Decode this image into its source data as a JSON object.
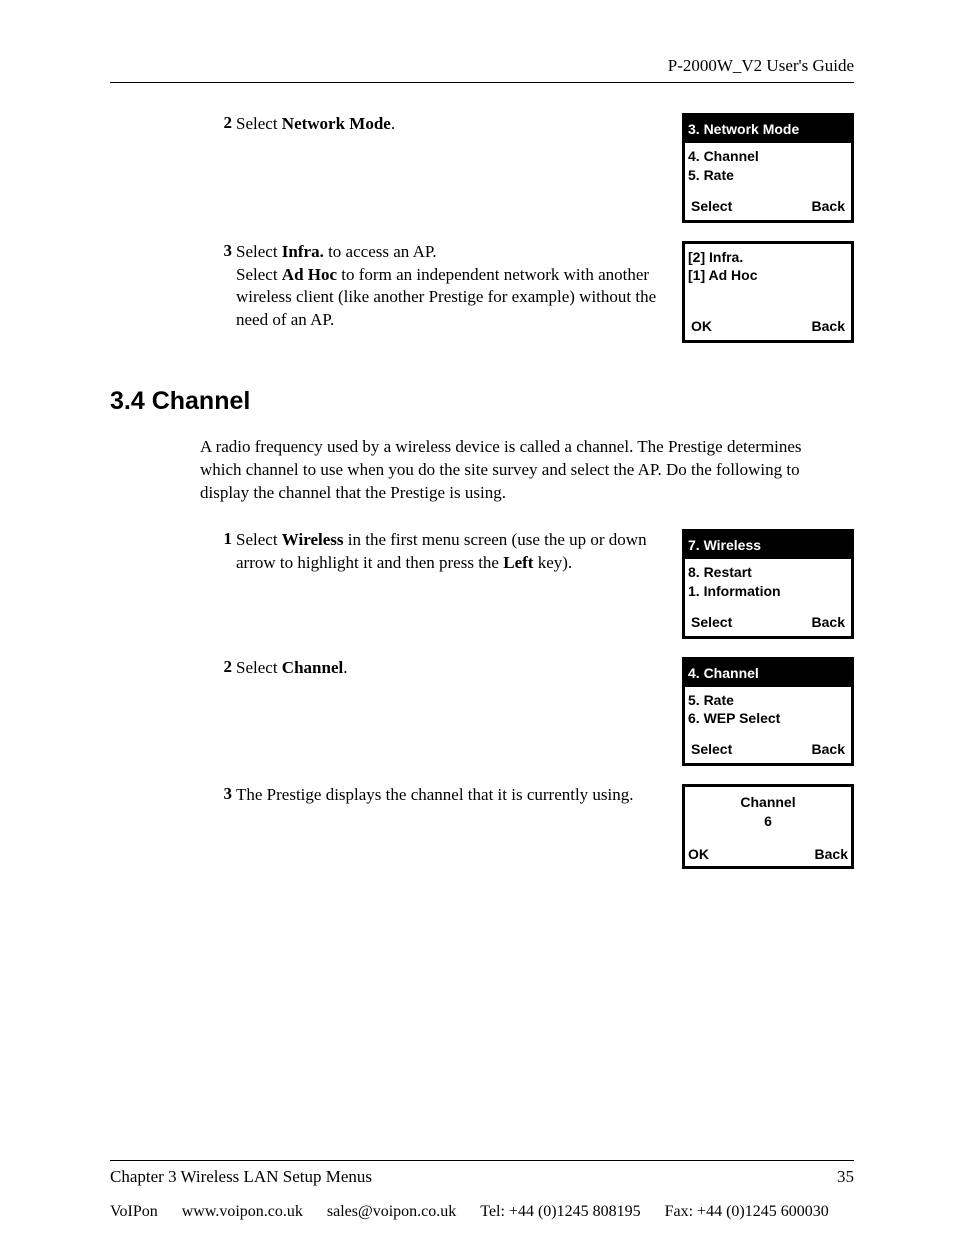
{
  "header": {
    "title": "P-2000W_V2 User's Guide"
  },
  "stepsA": [
    {
      "num": "2",
      "text_pre": "Select ",
      "bold1": "Network Mode",
      "text_post": ".",
      "screen": {
        "title": "3. Network Mode",
        "line1": "4. Channel",
        "line2": "5. Rate",
        "left": "Select",
        "right": "Back"
      }
    },
    {
      "num": "3",
      "text_pre": "Select ",
      "bold1": "Infra.",
      "text_mid1": " to access an AP.",
      "line2_pre": "Select ",
      "bold2": "Ad Hoc",
      "line2_post": " to form an independent network with another wireless client (like another Prestige for example) without the need of an AP.",
      "screen": {
        "title": "",
        "line1": "[2] Infra.",
        "line2": "[1] Ad Hoc",
        "left": "OK",
        "right": "Back"
      }
    }
  ],
  "section": {
    "heading": "3.4  Channel",
    "paragraph": "A radio frequency used by a wireless device is called a channel. The Prestige determines which channel to use when you do the site survey and select the AP. Do the following to display the channel that the Prestige is using."
  },
  "stepsB": [
    {
      "num": "1",
      "text_pre": "Select ",
      "bold1": "Wireless",
      "text_mid1": " in the first menu screen (use the up or down arrow to highlight it and then press the ",
      "bold2": "Left",
      "text_post": " key).",
      "screen": {
        "title": "7. Wireless",
        "line1": "8. Restart",
        "line2": "1. Information",
        "left": "Select",
        "right": "Back"
      }
    },
    {
      "num": "2",
      "text_pre": "Select ",
      "bold1": "Channel",
      "text_post": ".",
      "screen": {
        "title": "4. Channel",
        "line1": "5. Rate",
        "line2": "6. WEP Select",
        "left": "Select",
        "right": "Back"
      }
    },
    {
      "num": "3",
      "text_pre": "The Prestige displays the channel that it is currently using.",
      "screen": {
        "title": "",
        "center1": "Channel",
        "center2": "6",
        "left": "OK",
        "right": "Back"
      }
    }
  ],
  "footer": {
    "chapter": "Chapter 3 Wireless LAN Setup Menus",
    "page": "35",
    "company": "VoIPon",
    "web": "www.voipon.co.uk",
    "email": "sales@voipon.co.uk",
    "tel": "Tel: +44 (0)1245 808195",
    "fax": "Fax: +44 (0)1245 600030"
  }
}
